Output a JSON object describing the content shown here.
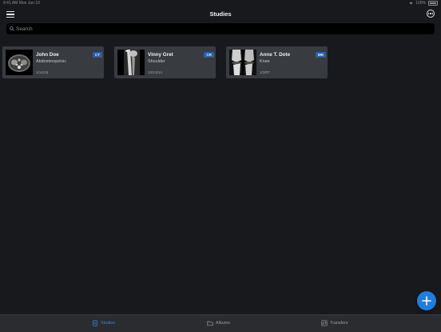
{
  "status_bar": {
    "time_date": "9:41 AM  Mon Jun 10",
    "battery": "100%"
  },
  "header": {
    "title": "Studies"
  },
  "search": {
    "placeholder": "Search"
  },
  "studies": [
    {
      "name": "John Doe",
      "body_part": "Abdominopelvic",
      "date": "1/14/16",
      "modality": "CT"
    },
    {
      "name": "Vinny Gret",
      "body_part": "Shoulder",
      "date": "12/13/14",
      "modality": "CR"
    },
    {
      "name": "Anne T. Dote",
      "body_part": "Knee",
      "date": "1/3/07",
      "modality": "MR"
    }
  ],
  "tabs": [
    {
      "label": "Studies",
      "icon": "studies-icon",
      "active": true
    },
    {
      "label": "Albums",
      "icon": "albums-icon",
      "active": false
    },
    {
      "label": "Transfers",
      "icon": "transfers-icon",
      "active": false
    }
  ],
  "colors": {
    "background": "#17191c",
    "card": "#383b40",
    "accent": "#1e7ee0",
    "badge": "#2c5fa8"
  }
}
